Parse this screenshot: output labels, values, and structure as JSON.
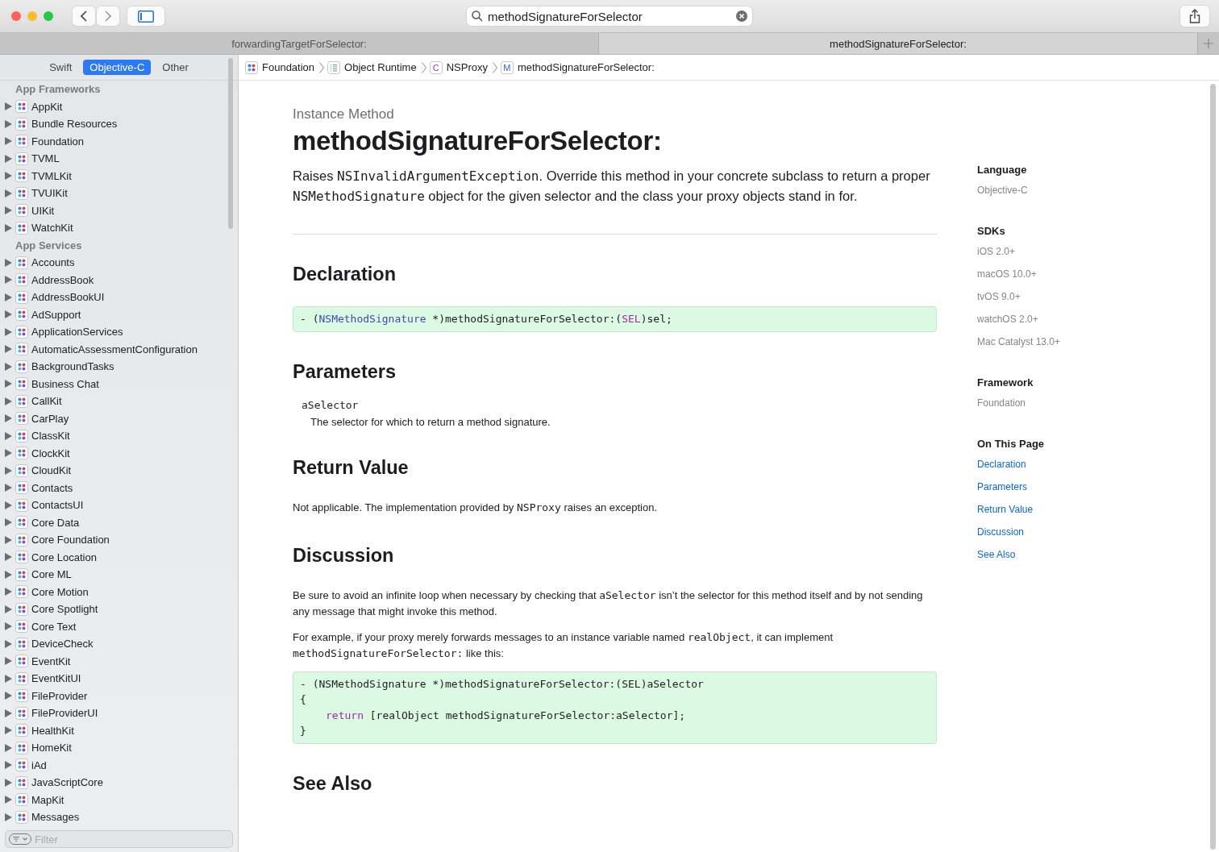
{
  "toolbar": {
    "search": {
      "value": "methodSignatureForSelector"
    }
  },
  "tabs": [
    {
      "label": "forwardingTargetForSelector:",
      "selected": false
    },
    {
      "label": "methodSignatureForSelector:",
      "selected": true
    }
  ],
  "sidebar": {
    "languages": [
      {
        "label": "Swift",
        "selected": false
      },
      {
        "label": "Objective-C",
        "selected": true
      },
      {
        "label": "Other",
        "selected": false
      }
    ],
    "sections": [
      {
        "title": "App Frameworks",
        "items": [
          "AppKit",
          "Bundle Resources",
          "Foundation",
          "TVML",
          "TVMLKit",
          "TVUIKit",
          "UIKit",
          "WatchKit"
        ]
      },
      {
        "title": "App Services",
        "items": [
          "Accounts",
          "AddressBook",
          "AddressBookUI",
          "AdSupport",
          "ApplicationServices",
          "AutomaticAssessmentConfiguration",
          "BackgroundTasks",
          "Business Chat",
          "CallKit",
          "CarPlay",
          "ClassKit",
          "ClockKit",
          "CloudKit",
          "Contacts",
          "ContactsUI",
          "Core Data",
          "Core Foundation",
          "Core Location",
          "Core ML",
          "Core Motion",
          "Core Spotlight",
          "Core Text",
          "DeviceCheck",
          "EventKit",
          "EventKitUI",
          "FileProvider",
          "FileProviderUI",
          "HealthKit",
          "HomeKit",
          "iAd",
          "JavaScriptCore",
          "MapKit",
          "Messages"
        ]
      }
    ],
    "filter": {
      "placeholder": "Filter"
    }
  },
  "breadcrumbs": [
    {
      "kind": "framework",
      "label": "Foundation"
    },
    {
      "kind": "collection",
      "label": "Object Runtime"
    },
    {
      "kind": "class",
      "badge": "C",
      "label": "NSProxy"
    },
    {
      "kind": "method",
      "badge": "M",
      "label": "methodSignatureForSelector:"
    }
  ],
  "article": {
    "eyebrow": "Instance Method",
    "title": "methodSignatureForSelector:",
    "abstract": [
      {
        "kind": "text",
        "text": "Raises "
      },
      {
        "kind": "code",
        "text": "NSInvalidArgumentException"
      },
      {
        "kind": "text",
        "text": ". Override this method in your concrete subclass to return a proper "
      },
      {
        "kind": "code",
        "text": "NSMethodSignature"
      },
      {
        "kind": "text",
        "text": " object for the given selector and the class your proxy objects stand in for."
      }
    ],
    "sections": [
      {
        "heading": "Declaration",
        "blocks": [
          {
            "kind": "code",
            "lines": [
              {
                "indent": false,
                "tokens": [
                  {
                    "kind": "plain",
                    "text": "- ("
                  },
                  {
                    "kind": "type",
                    "text": "NSMethodSignature"
                  },
                  {
                    "kind": "plain",
                    "text": " *)methodSignatureForSelector:("
                  },
                  {
                    "kind": "keyword",
                    "text": "SEL"
                  },
                  {
                    "kind": "plain",
                    "text": ")sel;"
                  }
                ]
              }
            ]
          }
        ]
      },
      {
        "heading": "Parameters",
        "blocks": [
          {
            "kind": "param",
            "name": "aSelector",
            "description": "The selector for which to return a method signature."
          }
        ]
      },
      {
        "heading": "Return Value",
        "blocks": [
          {
            "kind": "paragraph",
            "parts": [
              {
                "kind": "text",
                "text": "Not applicable. The implementation provided by "
              },
              {
                "kind": "code",
                "text": "NSProxy"
              },
              {
                "kind": "text",
                "text": " raises an exception."
              }
            ]
          }
        ]
      },
      {
        "heading": "Discussion",
        "blocks": [
          {
            "kind": "paragraph",
            "parts": [
              {
                "kind": "text",
                "text": "Be sure to avoid an infinite loop when necessary by checking that "
              },
              {
                "kind": "code",
                "text": "aSelector"
              },
              {
                "kind": "text",
                "text": " isn’t the selector for this method itself and by not sending any message that might invoke this method."
              }
            ]
          },
          {
            "kind": "paragraph",
            "parts": [
              {
                "kind": "text",
                "text": "For example, if your proxy merely forwards messages to an instance variable named "
              },
              {
                "kind": "code",
                "text": "realObject"
              },
              {
                "kind": "text",
                "text": ", it can implement "
              },
              {
                "kind": "code",
                "text": "methodSignatureForSelector:"
              },
              {
                "kind": "text",
                "text": " like this:"
              }
            ]
          },
          {
            "kind": "code",
            "lines": [
              {
                "indent": false,
                "tokens": [
                  {
                    "kind": "plain",
                    "text": "- (NSMethodSignature *)methodSignatureForSelector:(SEL)aSelector"
                  }
                ]
              },
              {
                "indent": false,
                "tokens": [
                  {
                    "kind": "plain",
                    "text": "{"
                  }
                ]
              },
              {
                "indent": true,
                "tokens": [
                  {
                    "kind": "keyword",
                    "text": "return"
                  },
                  {
                    "kind": "plain",
                    "text": " [realObject methodSignatureForSelector:aSelector];"
                  }
                ]
              },
              {
                "indent": false,
                "tokens": [
                  {
                    "kind": "plain",
                    "text": "}"
                  }
                ]
              }
            ]
          }
        ]
      },
      {
        "heading": "See Also"
      }
    ]
  },
  "aside": [
    {
      "heading": "Language",
      "items": [
        {
          "kind": "plain",
          "text": "Objective-C"
        }
      ]
    },
    {
      "heading": "SDKs",
      "items": [
        {
          "kind": "plain",
          "text": "iOS 2.0+"
        },
        {
          "kind": "plain",
          "text": "macOS 10.0+"
        },
        {
          "kind": "plain",
          "text": "tvOS 9.0+"
        },
        {
          "kind": "plain",
          "text": "watchOS 2.0+"
        },
        {
          "kind": "plain",
          "text": "Mac Catalyst 13.0+"
        }
      ]
    },
    {
      "heading": "Framework",
      "items": [
        {
          "kind": "plain",
          "text": "Foundation"
        }
      ]
    },
    {
      "heading": "On This Page",
      "items": [
        {
          "kind": "link",
          "text": "Declaration"
        },
        {
          "kind": "link",
          "text": "Parameters"
        },
        {
          "kind": "link",
          "text": "Return Value"
        },
        {
          "kind": "link",
          "text": "Discussion"
        },
        {
          "kind": "link",
          "text": "See Also"
        }
      ]
    }
  ]
}
